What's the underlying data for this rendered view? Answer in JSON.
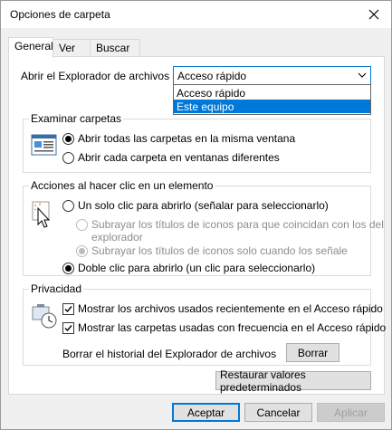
{
  "window": {
    "title": "Opciones de carpeta"
  },
  "tabs": [
    {
      "label": "General",
      "active": true
    },
    {
      "label": "Ver",
      "active": false
    },
    {
      "label": "Buscar",
      "active": false
    }
  ],
  "open_explorer": {
    "label": "Abrir el Explorador de archivos en:",
    "selected": "Acceso rápido",
    "options": [
      {
        "label": "Acceso rápido",
        "highlighted": false
      },
      {
        "label": "Este equipo",
        "highlighted": true
      }
    ]
  },
  "browse_folders": {
    "title": "Examinar carpetas",
    "options": [
      {
        "label": "Abrir todas las carpetas en la misma ventana",
        "checked": true
      },
      {
        "label": "Abrir cada carpeta en ventanas diferentes",
        "checked": false
      }
    ]
  },
  "click_actions": {
    "title": "Acciones al hacer clic en un elemento",
    "single_click": "Un solo clic para abrirlo (señalar para seleccionarlo)",
    "underline_consistent_line1": "Subrayar los títulos de iconos para que coincidan con los del",
    "underline_consistent_line2": "explorador",
    "underline_on_point": "Subrayar los títulos de iconos solo cuando los señale",
    "double_click": "Doble clic para abrirlo (un clic para seleccionarlo)"
  },
  "privacy": {
    "title": "Privacidad",
    "show_recent_files": "Mostrar los archivos usados recientemente en el Acceso rápido",
    "show_frequent_folders": "Mostrar las carpetas usadas con frecuencia en el Acceso rápido",
    "clear_history_label": "Borrar el historial del Explorador de archivos",
    "clear_button": "Borrar"
  },
  "restore_defaults": "Restaurar valores predeterminados",
  "footer": {
    "ok": "Aceptar",
    "cancel": "Cancelar",
    "apply": "Aplicar"
  },
  "colors": {
    "accent": "#0078d7",
    "panel_bg": "#ffffff",
    "window_bg": "#f0f0f0"
  }
}
